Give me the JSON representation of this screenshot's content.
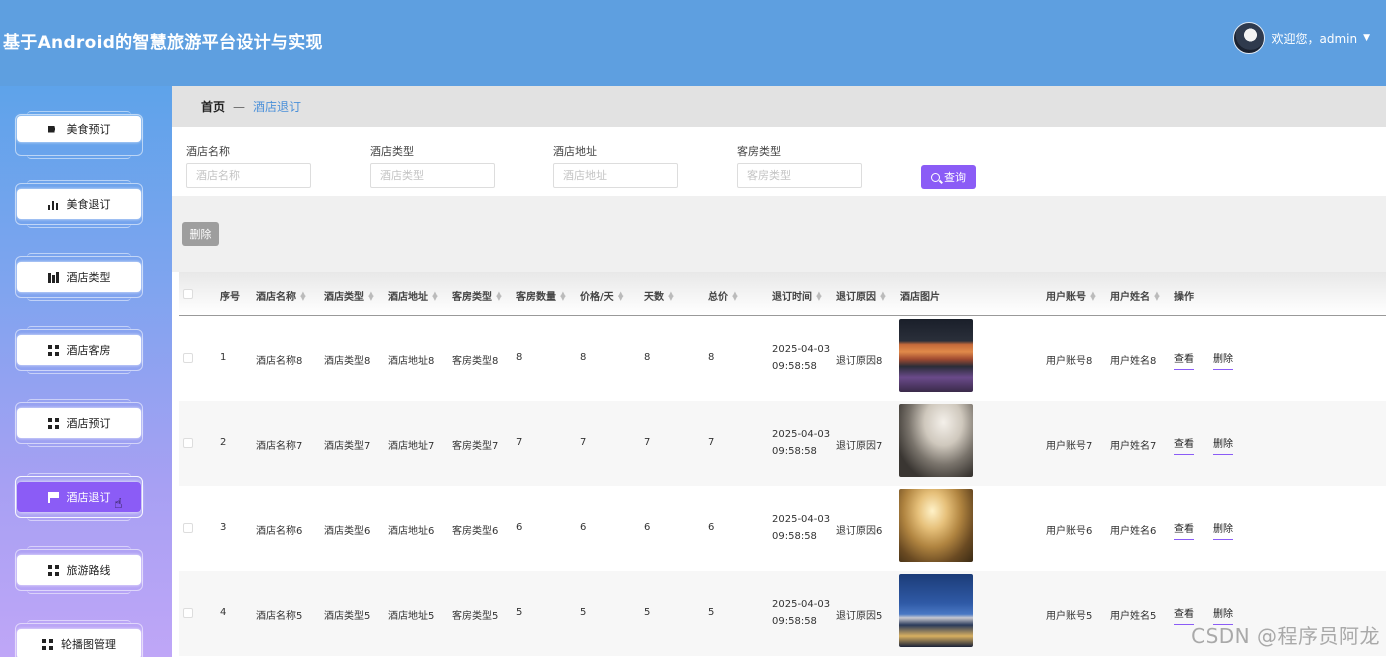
{
  "header": {
    "title": "基于Android的智慧旅游平台设计与实现",
    "welcome": "欢迎您，admin"
  },
  "sidebar": {
    "items": [
      {
        "label": "美食预订",
        "icon": "video-camera-icon"
      },
      {
        "label": "美食退订",
        "icon": "bar-chart-icon"
      },
      {
        "label": "酒店类型",
        "icon": "books-icon"
      },
      {
        "label": "酒店客房",
        "icon": "grid-icon"
      },
      {
        "label": "酒店预订",
        "icon": "grid-icon"
      },
      {
        "label": "酒店退订",
        "icon": "flag-icon",
        "active": true
      },
      {
        "label": "旅游路线",
        "icon": "grid-icon"
      },
      {
        "label": "轮播图管理",
        "icon": "grid-icon"
      }
    ]
  },
  "breadcrumb": {
    "home": "首页",
    "separator": "—",
    "current": "酒店退订"
  },
  "search": {
    "fields": [
      {
        "label": "酒店名称",
        "placeholder": "酒店名称"
      },
      {
        "label": "酒店类型",
        "placeholder": "酒店类型"
      },
      {
        "label": "酒店地址",
        "placeholder": "酒店地址"
      },
      {
        "label": "客房类型",
        "placeholder": "客房类型"
      }
    ],
    "button": "查询"
  },
  "actions": {
    "delete": "删除"
  },
  "table": {
    "columns": [
      "序号",
      "酒店名称",
      "酒店类型",
      "酒店地址",
      "客房类型",
      "客房数量",
      "价格/天",
      "天数",
      "总价",
      "退订时间",
      "退订原因",
      "酒店图片",
      "用户账号",
      "用户姓名",
      "操作"
    ],
    "rows": [
      {
        "index": "1",
        "name": "酒店名称8",
        "type": "酒店类型8",
        "address": "酒店地址8",
        "room_type": "客房类型8",
        "rooms": "8",
        "price": "8",
        "days": "8",
        "total": "8",
        "date": "2025-04-03",
        "time": "09:58:58",
        "reason": "退订原因8",
        "account": "用户账号8",
        "username": "用户姓名8",
        "view": "查看",
        "delete": "删除"
      },
      {
        "index": "2",
        "name": "酒店名称7",
        "type": "酒店类型7",
        "address": "酒店地址7",
        "room_type": "客房类型7",
        "rooms": "7",
        "price": "7",
        "days": "7",
        "total": "7",
        "date": "2025-04-03",
        "time": "09:58:58",
        "reason": "退订原因7",
        "account": "用户账号7",
        "username": "用户姓名7",
        "view": "查看",
        "delete": "删除"
      },
      {
        "index": "3",
        "name": "酒店名称6",
        "type": "酒店类型6",
        "address": "酒店地址6",
        "room_type": "客房类型6",
        "rooms": "6",
        "price": "6",
        "days": "6",
        "total": "6",
        "date": "2025-04-03",
        "time": "09:58:58",
        "reason": "退订原因6",
        "account": "用户账号6",
        "username": "用户姓名6",
        "view": "查看",
        "delete": "删除"
      },
      {
        "index": "4",
        "name": "酒店名称5",
        "type": "酒店类型5",
        "address": "酒店地址5",
        "room_type": "客房类型5",
        "rooms": "5",
        "price": "5",
        "days": "5",
        "total": "5",
        "date": "2025-04-03",
        "time": "09:58:58",
        "reason": "退订原因5",
        "account": "用户账号5",
        "username": "用户姓名5",
        "view": "查看",
        "delete": "删除"
      }
    ]
  },
  "watermark": "CSDN @程序员阿龙",
  "colors": {
    "header": "#5e9fe0",
    "accent": "#8b5cf6",
    "breadcrumb_link": "#4a90d9"
  }
}
